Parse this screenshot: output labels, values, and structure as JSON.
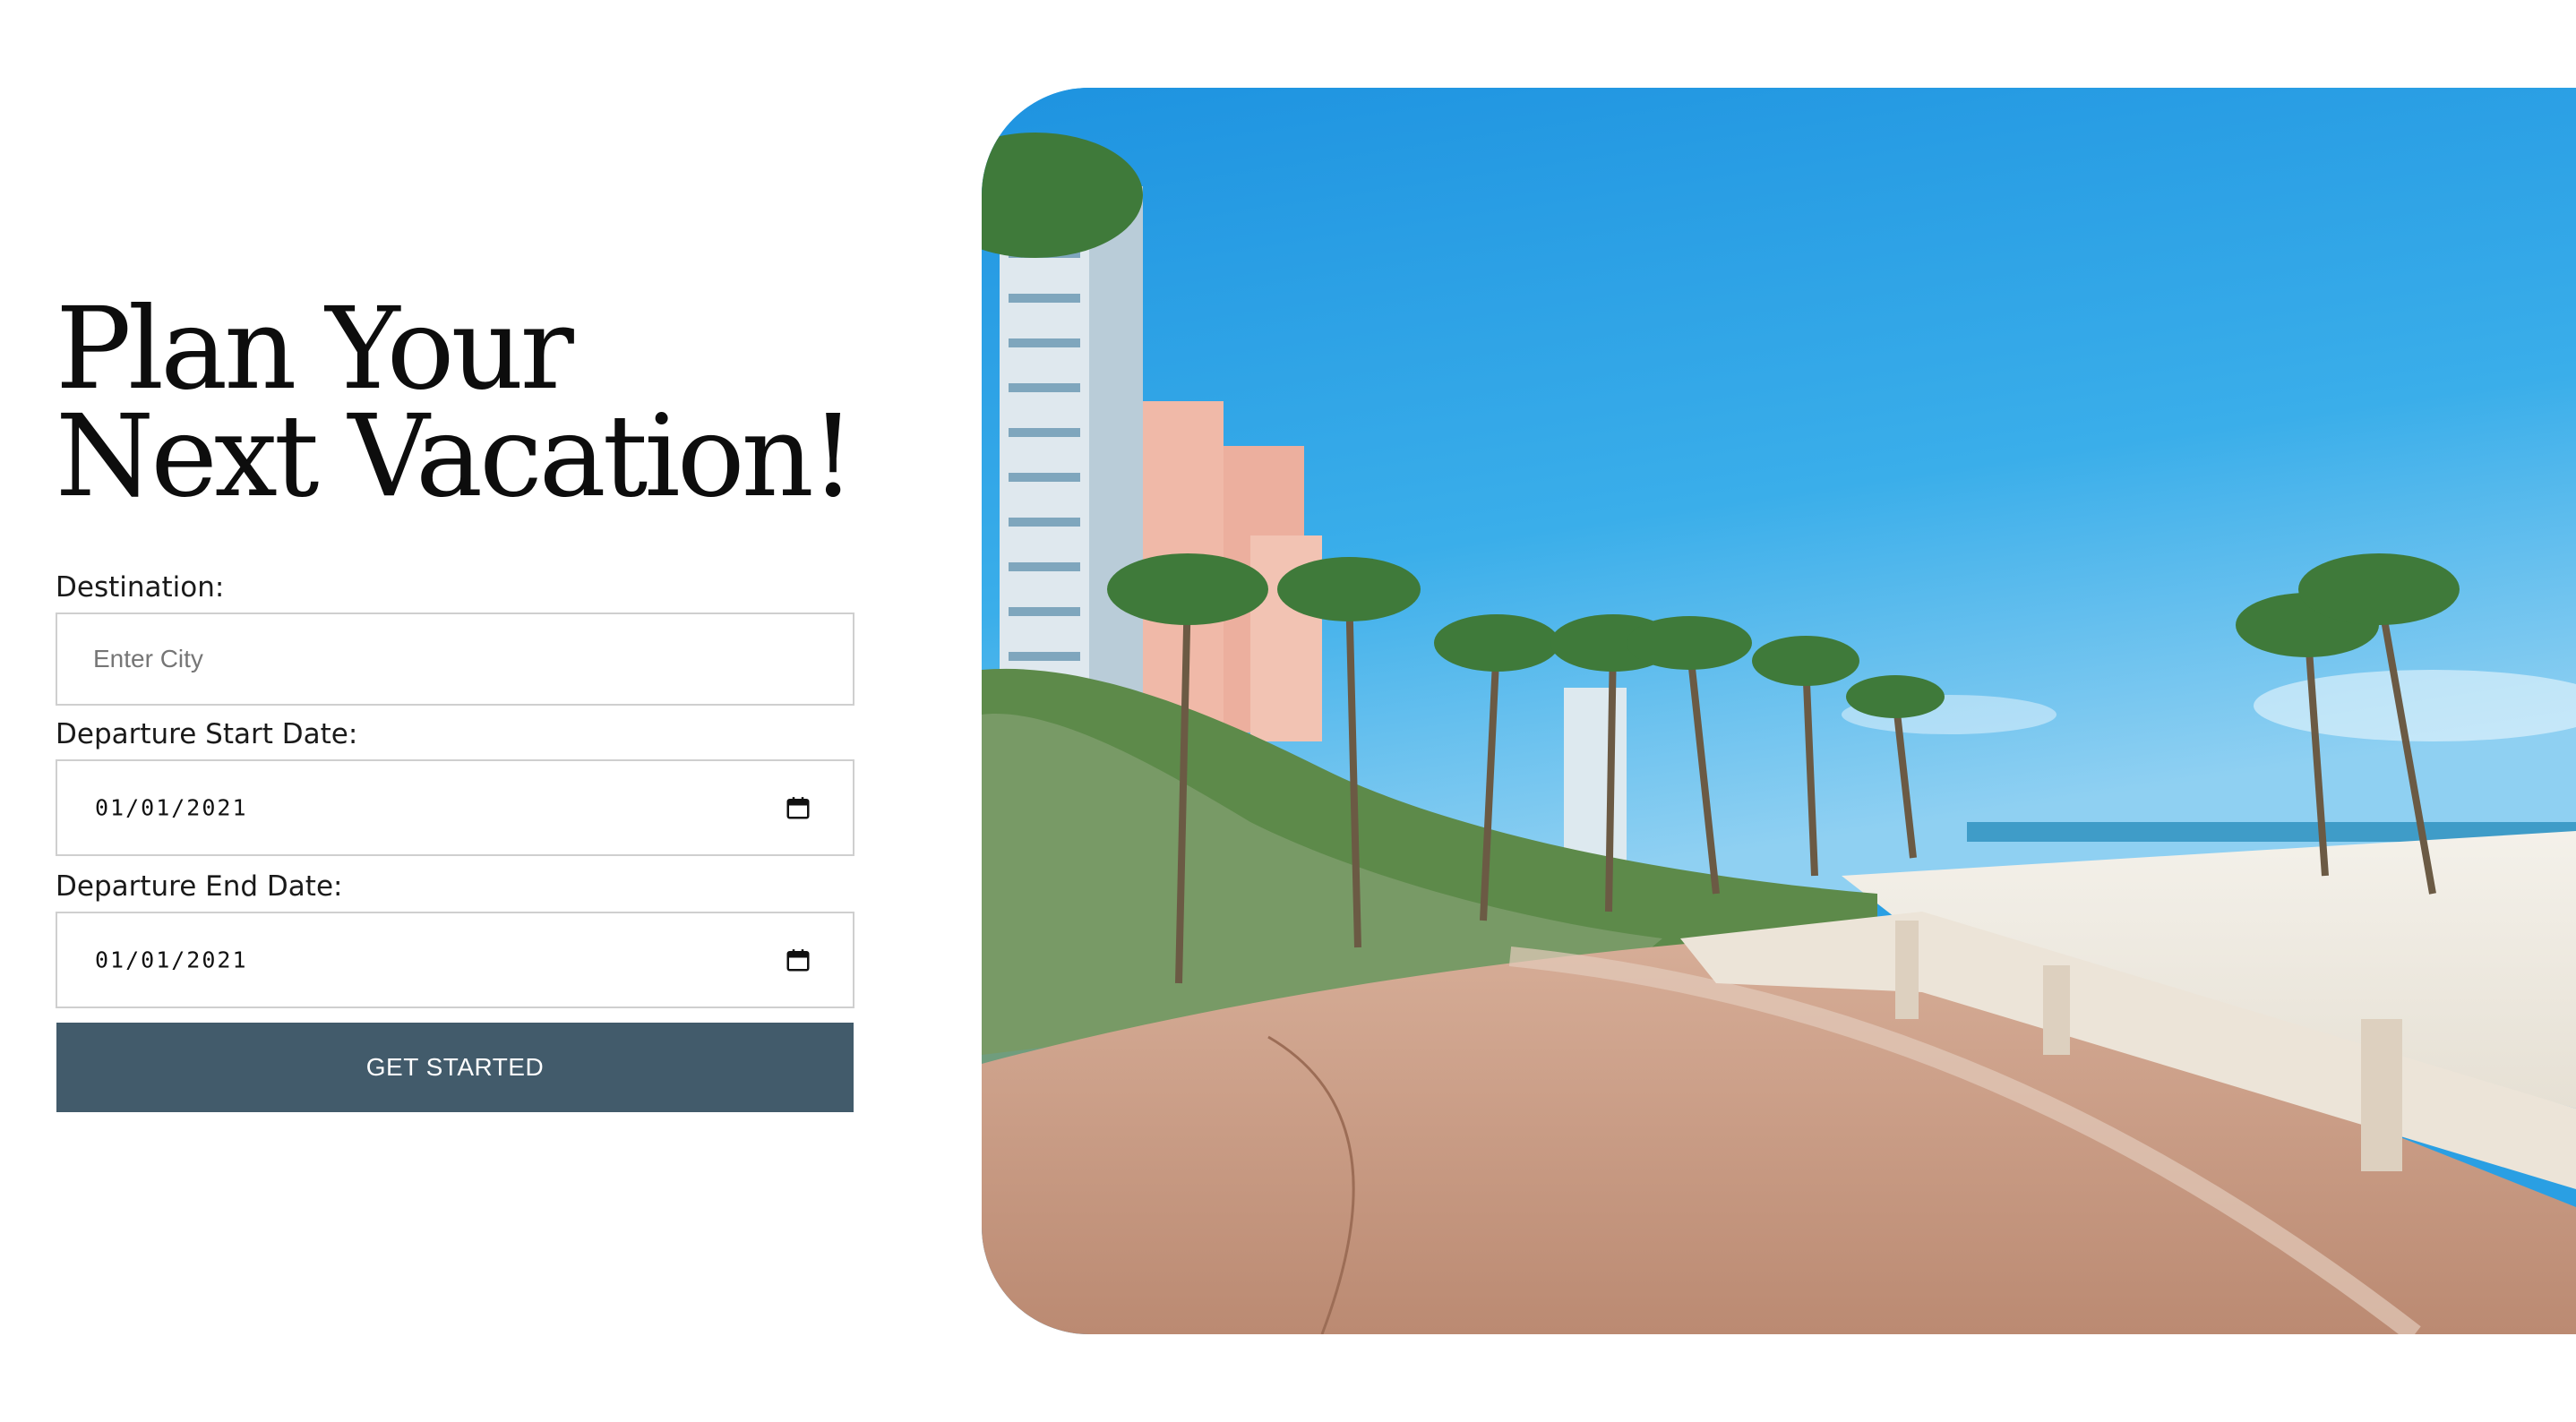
{
  "hero": {
    "headline_line1": "Plan Your",
    "headline_line2": "Next Vacation!"
  },
  "form": {
    "destination": {
      "label": "Destination:",
      "placeholder": "Enter City",
      "value": ""
    },
    "start_date": {
      "label": "Departure Start Date:",
      "value": "01/01/2021",
      "icon": "calendar-icon"
    },
    "end_date": {
      "label": "Departure End Date:",
      "value": "01/01/2021",
      "icon": "calendar-icon"
    },
    "submit_label": "GET STARTED"
  },
  "image": {
    "subject": "beach-boardwalk-photo"
  },
  "colors": {
    "button_bg": "#425b6b",
    "button_text": "#ffffff",
    "input_border": "#cfcfcf",
    "headline": "#0d0d0d",
    "sky": "#2a9fe3",
    "sand": "#f2efe8",
    "walkway": "#c4957c"
  }
}
